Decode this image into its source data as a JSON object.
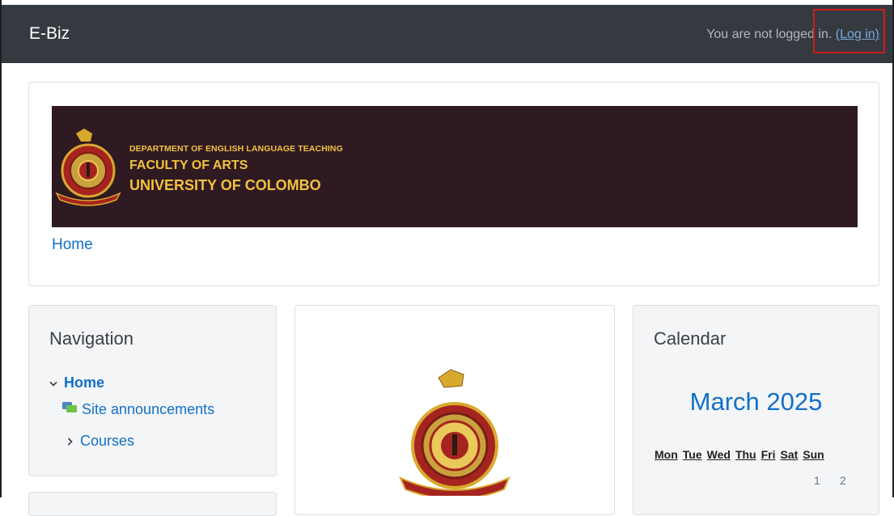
{
  "navbar": {
    "brand": "E-Biz",
    "not_logged_in": "You are not logged in.",
    "login_label": "(Log in)"
  },
  "banner": {
    "line1": "DEPARTMENT OF ENGLISH LANGUAGE TEACHING",
    "line2": "FACULTY OF ARTS",
    "line3": "UNIVERSITY OF COLOMBO",
    "colors": {
      "background": "#2f1a21",
      "text": "#f2c23f"
    }
  },
  "breadcrumb": {
    "home": "Home"
  },
  "navigation_block": {
    "title": "Navigation",
    "home": "Home",
    "items": [
      {
        "label": "Site announcements",
        "icon": "forum-icon"
      },
      {
        "label": "Courses",
        "icon": "chevron-right-icon"
      }
    ]
  },
  "calendar": {
    "title": "Calendar",
    "month": "March 2025",
    "weekdays": [
      "Mon",
      "Tue",
      "Wed",
      "Thu",
      "Fri",
      "Sat",
      "Sun"
    ],
    "first_row": [
      "1",
      "2"
    ]
  },
  "colors": {
    "navbar": "#343a40",
    "link": "#1270c8",
    "highlight_box": "#d11b1b"
  }
}
